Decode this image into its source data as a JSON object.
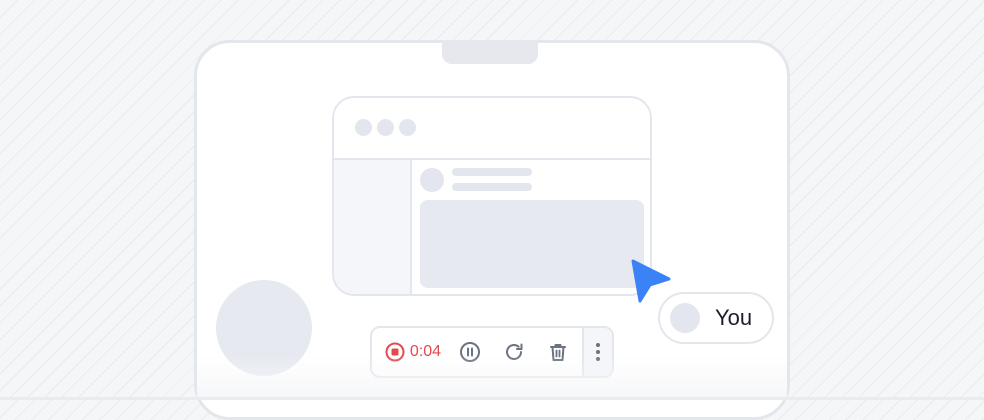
{
  "presenter": {
    "name": "You"
  },
  "recording": {
    "time": "0:04",
    "color": "#e5484d"
  },
  "toolbar": {
    "stop_icon": "stop-recording-icon",
    "pause_icon": "pause-icon",
    "restart_icon": "restart-icon",
    "delete_icon": "trash-icon",
    "more_icon": "more-vertical-icon"
  },
  "colors": {
    "cursor": "#3b82f6",
    "icon_gray": "#6b7280",
    "border": "#e3e6ec",
    "placeholder": "#e3e6ee"
  }
}
